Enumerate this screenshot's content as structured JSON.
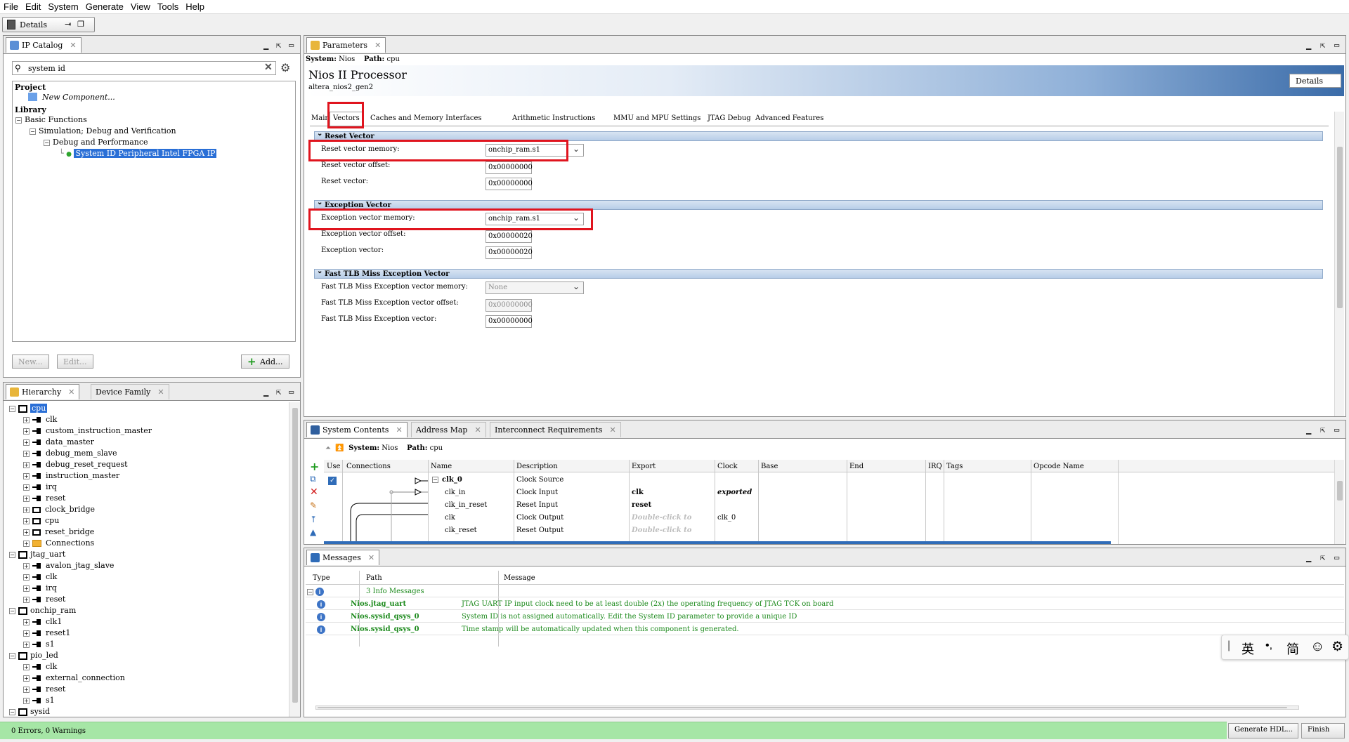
{
  "menu": [
    "File",
    "Edit",
    "System",
    "Generate",
    "View",
    "Tools",
    "Help"
  ],
  "toolbar": {
    "details_tab": "Details"
  },
  "ip_catalog": {
    "tab": "IP Catalog",
    "search_value": "system id",
    "tree": [
      {
        "text": "Project",
        "bold": true
      },
      {
        "text": "New Component...",
        "italic": true
      },
      {
        "text": "Library",
        "bold": true
      },
      {
        "text": "Basic Functions"
      },
      {
        "text": "Simulation; Debug and Verification"
      },
      {
        "text": "Debug and Performance"
      },
      {
        "text": "System ID Peripheral Intel FPGA IP",
        "selected": true
      }
    ],
    "new_button": "New...",
    "edit_button": "Edit...",
    "add_button": "Add..."
  },
  "hierarchy": {
    "tab1": "Hierarchy",
    "tab2": "Device Family",
    "items": [
      {
        "level": 0,
        "text": "cpu",
        "selected": true,
        "type": "component"
      },
      {
        "level": 1,
        "text": "clk",
        "type": "in"
      },
      {
        "level": 1,
        "text": "custom_instruction_master",
        "type": "out"
      },
      {
        "level": 1,
        "text": "data_master",
        "type": "out"
      },
      {
        "level": 1,
        "text": "debug_mem_slave",
        "type": "out"
      },
      {
        "level": 1,
        "text": "debug_reset_request",
        "type": "in"
      },
      {
        "level": 1,
        "text": "instruction_master",
        "type": "out"
      },
      {
        "level": 1,
        "text": "irq",
        "type": "in"
      },
      {
        "level": 1,
        "text": "reset",
        "type": "in"
      },
      {
        "level": 1,
        "text": "clock_bridge",
        "type": "sub"
      },
      {
        "level": 1,
        "text": "cpu",
        "type": "sub"
      },
      {
        "level": 1,
        "text": "reset_bridge",
        "type": "sub"
      },
      {
        "level": 1,
        "text": "Connections",
        "type": "folder"
      },
      {
        "level": 0,
        "text": "jtag_uart",
        "type": "component"
      },
      {
        "level": 1,
        "text": "avalon_jtag_slave",
        "type": "in"
      },
      {
        "level": 1,
        "text": "clk",
        "type": "in"
      },
      {
        "level": 1,
        "text": "irq",
        "type": "in"
      },
      {
        "level": 1,
        "text": "reset",
        "type": "in"
      },
      {
        "level": 0,
        "text": "onchip_ram",
        "type": "component"
      },
      {
        "level": 1,
        "text": "clk1",
        "type": "in"
      },
      {
        "level": 1,
        "text": "reset1",
        "type": "in"
      },
      {
        "level": 1,
        "text": "s1",
        "type": "in"
      },
      {
        "level": 0,
        "text": "pio_led",
        "type": "component"
      },
      {
        "level": 1,
        "text": "clk",
        "type": "in"
      },
      {
        "level": 1,
        "text": "external_connection",
        "type": "in"
      },
      {
        "level": 1,
        "text": "reset",
        "type": "in"
      },
      {
        "level": 1,
        "text": "s1",
        "type": "in"
      },
      {
        "level": 0,
        "text": "sysid",
        "type": "component"
      }
    ]
  },
  "parameters": {
    "tab": "Parameters",
    "system_label": "System:",
    "system_value": "Nios",
    "path_label": "Path:",
    "path_value": "cpu",
    "title": "Nios II Processor",
    "subtitle": "altera_nios2_gen2",
    "details_button": "Details",
    "tabs": [
      "Main",
      "Vectors",
      "Caches and Memory Interfaces",
      "Arithmetic Instructions",
      "MMU and MPU Settings",
      "JTAG Debug",
      "Advanced Features"
    ],
    "reset_section": "Reset Vector",
    "reset_memory_label": "Reset vector memory:",
    "reset_memory_value": "onchip_ram.s1",
    "reset_offset_label": "Reset vector offset:",
    "reset_offset_value": "0x00000000",
    "reset_vector_label": "Reset vector:",
    "reset_vector_value": "0x00000000",
    "exception_section": "Exception Vector",
    "exception_memory_label": "Exception vector memory:",
    "exception_memory_value": "onchip_ram.s1",
    "exception_offset_label": "Exception vector offset:",
    "exception_offset_value": "0x00000020",
    "exception_vector_label": "Exception vector:",
    "exception_vector_value": "0x00000020",
    "tlb_section": "Fast TLB Miss Exception Vector",
    "tlb_memory_label": "Fast TLB Miss Exception vector memory:",
    "tlb_memory_value": "None",
    "tlb_offset_label": "Fast TLB Miss Exception vector offset:",
    "tlb_offset_value": "0x00000000",
    "tlb_vector_label": "Fast TLB Miss Exception vector:",
    "tlb_vector_value": "0x00000000"
  },
  "system_contents": {
    "tab1": "System Contents",
    "tab2": "Address Map",
    "tab3": "Interconnect Requirements",
    "system_label": "System:",
    "system_value": "Nios",
    "path_label": "Path:",
    "path_value": "cpu",
    "columns": [
      "Use",
      "Connections",
      "Name",
      "Description",
      "Export",
      "Clock",
      "Base",
      "End",
      "IRQ",
      "Tags",
      "Opcode Name"
    ],
    "rows": [
      {
        "name": "clk_0",
        "desc": "Clock Source",
        "export": "",
        "clock": "",
        "bold": true
      },
      {
        "name": "clk_in",
        "desc": "Clock Input",
        "export": "clk",
        "clock": "exported"
      },
      {
        "name": "clk_in_reset",
        "desc": "Reset Input",
        "export": "reset",
        "clock": ""
      },
      {
        "name": "clk",
        "desc": "Clock Output",
        "export": "Double-click to",
        "clock": "clk_0"
      },
      {
        "name": "clk_reset",
        "desc": "Reset Output",
        "export": "Double-click to",
        "clock": ""
      }
    ]
  },
  "messages": {
    "tab": "Messages",
    "columns": [
      "Type",
      "Path",
      "Message"
    ],
    "summary": "3 Info Messages",
    "rows": [
      {
        "path": "Nios.jtag_uart",
        "message": "JTAG UART IP input clock need to be at least double (2x) the operating frequency of JTAG TCK on board"
      },
      {
        "path": "Nios.sysid_qsys_0",
        "message": "System ID is not assigned automatically. Edit the System ID parameter to provide a unique ID"
      },
      {
        "path": "Nios.sysid_qsys_0",
        "message": "Time stamp will be automatically updated when this component is generated."
      }
    ]
  },
  "ime": {
    "lang": "英",
    "punct": "•,",
    "mode": "简"
  },
  "status": {
    "text": "0 Errors, 0 Warnings",
    "generate_button": "Generate HDL...",
    "finish_button": "Finish"
  }
}
